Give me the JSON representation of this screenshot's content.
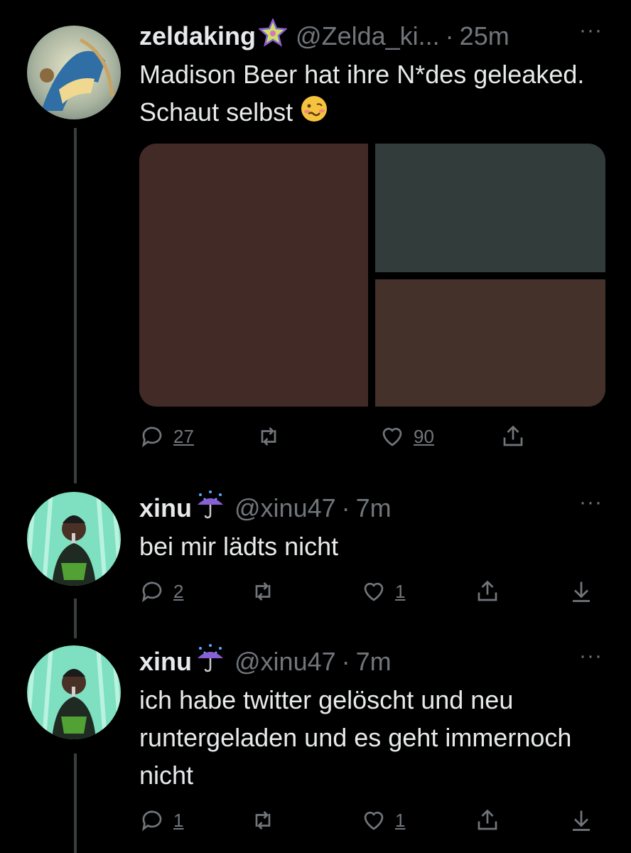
{
  "tweets": [
    {
      "name": "zeldaking",
      "handle": "@Zelda_ki...",
      "time": "25m",
      "text": "Madison Beer hat ihre N*des geleaked. Schaut selbst",
      "badge_icon": "sparkle-star",
      "more": "···",
      "replies": "27",
      "retweets": "",
      "likes": "90"
    },
    {
      "name": "xinu",
      "handle": "@xinu47",
      "time": "7m",
      "text": "bei mir lädts nicht",
      "badge_icon": "umbrella-rain",
      "more": "···",
      "replies": "2",
      "retweets": "",
      "likes": "1"
    },
    {
      "name": "xinu",
      "handle": "@xinu47",
      "time": "7m",
      "text": "ich habe twitter gelöscht und neu runtergeladen und es geht immernoch nicht",
      "badge_icon": "umbrella-rain",
      "more": "···",
      "replies": "1",
      "retweets": "",
      "likes": "1"
    }
  ],
  "sep": "·",
  "colors": {
    "background": "#000000",
    "text": "#e7e9ea",
    "muted": "#71767b",
    "thread": "#3a3d40"
  }
}
